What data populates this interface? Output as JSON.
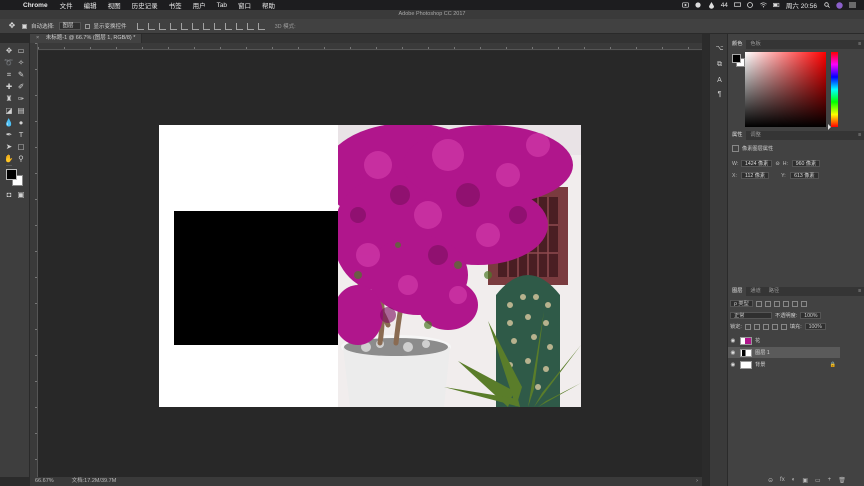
{
  "menubar": {
    "apple_icon": "apple-icon",
    "app": "Chrome",
    "items": [
      "文件",
      "编辑",
      "视图",
      "历史记录",
      "书签",
      "用户",
      "Tab",
      "窗口",
      "帮助"
    ],
    "battery_text": "44",
    "time": "周六 20:56"
  },
  "ps": {
    "window_title": "Adobe Photoshop CC 2017"
  },
  "options": {
    "auto_select_label": "自动选择:",
    "auto_select_value": "图层",
    "show_transform_label": "显示变换控件",
    "mode3d_label": "3D 模式:"
  },
  "document": {
    "tab_close": "×",
    "tab_title": "未标题-1 @ 66.7% (图层 1, RGB/8) *"
  },
  "statusbar": {
    "zoom": "66.67%",
    "doc_size": "文档:17.2M/39.7M",
    "arrow": "›"
  },
  "color_panel": {
    "tabs": [
      "颜色",
      "色板"
    ]
  },
  "properties_panel": {
    "tabs": [
      "属性",
      "调整"
    ],
    "section_title": "像素图层属性",
    "w_label": "W:",
    "w_value": "1424 像素",
    "h_label": "H:",
    "h_value": "960 像素",
    "x_label": "X:",
    "x_value": "112 像素",
    "y_label": "Y:",
    "y_value": "613 像素",
    "link_icon": "link-icon"
  },
  "layers_panel": {
    "tabs": [
      "图层",
      "通道",
      "路径"
    ],
    "filter_label": "ρ 类型",
    "blend_mode": "正常",
    "opacity_label": "不透明度:",
    "opacity_value": "100%",
    "lock_label": "锁定:",
    "fill_label": "填充:",
    "fill_value": "100%",
    "layers": [
      {
        "name": "花",
        "visible": true,
        "selected": false,
        "locked": false
      },
      {
        "name": "图层 1",
        "visible": true,
        "selected": true,
        "locked": false
      },
      {
        "name": "背景",
        "visible": true,
        "selected": false,
        "locked": true
      }
    ],
    "footer_icons": [
      "fx",
      "◐",
      "▣",
      "▭",
      "+",
      "🗑"
    ]
  },
  "colors": {
    "menubar": "#1d1d1f",
    "app_bg": "#2b2b2b",
    "canvas_bg": "#282828",
    "panel_bg": "#424242",
    "selected_layer": "#5a5a5a",
    "flower_magenta": "#b0168c",
    "leaf_green": "#5a7d2a"
  }
}
